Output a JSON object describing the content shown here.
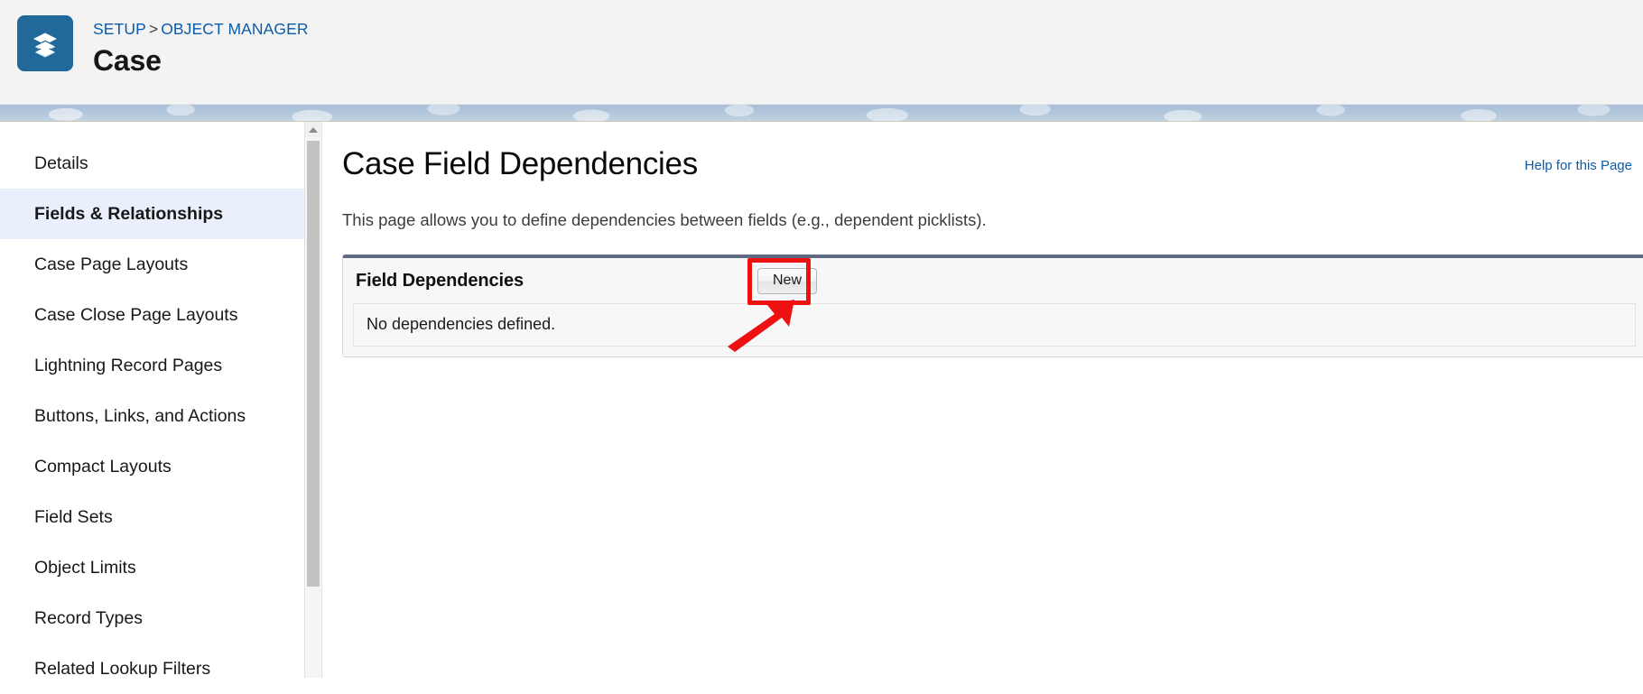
{
  "header": {
    "object_icon": "layers-stack-icon",
    "icon_color": "#21699b",
    "breadcrumb": {
      "setup": "SETUP",
      "separator": ">",
      "object_manager": "OBJECT MANAGER"
    },
    "title": "Case"
  },
  "sidebar": {
    "items": [
      {
        "label": "Details",
        "active": false
      },
      {
        "label": "Fields & Relationships",
        "active": true
      },
      {
        "label": "Case Page Layouts",
        "active": false
      },
      {
        "label": "Case Close Page Layouts",
        "active": false
      },
      {
        "label": "Lightning Record Pages",
        "active": false
      },
      {
        "label": "Buttons, Links, and Actions",
        "active": false
      },
      {
        "label": "Compact Layouts",
        "active": false
      },
      {
        "label": "Field Sets",
        "active": false
      },
      {
        "label": "Object Limits",
        "active": false
      },
      {
        "label": "Record Types",
        "active": false
      },
      {
        "label": "Related Lookup Filters",
        "active": false
      }
    ],
    "active_bg": "#e9f0fb"
  },
  "scrollbar": {
    "up_arrow_icon": "triangle-up-icon",
    "thumb_color": "#c2c2c2"
  },
  "main": {
    "help_link": "Help for this Page",
    "title": "Case Field Dependencies",
    "description": "This page allows you to define dependencies between fields (e.g., dependent picklists)."
  },
  "panel": {
    "title": "Field Dependencies",
    "new_button": "New",
    "empty_message": "No dependencies defined.",
    "accent_color": "#5d6a82"
  },
  "annotation": {
    "highlight_color": "#ee1111",
    "highlight_target": "New",
    "arrow_direction": "up-right"
  }
}
